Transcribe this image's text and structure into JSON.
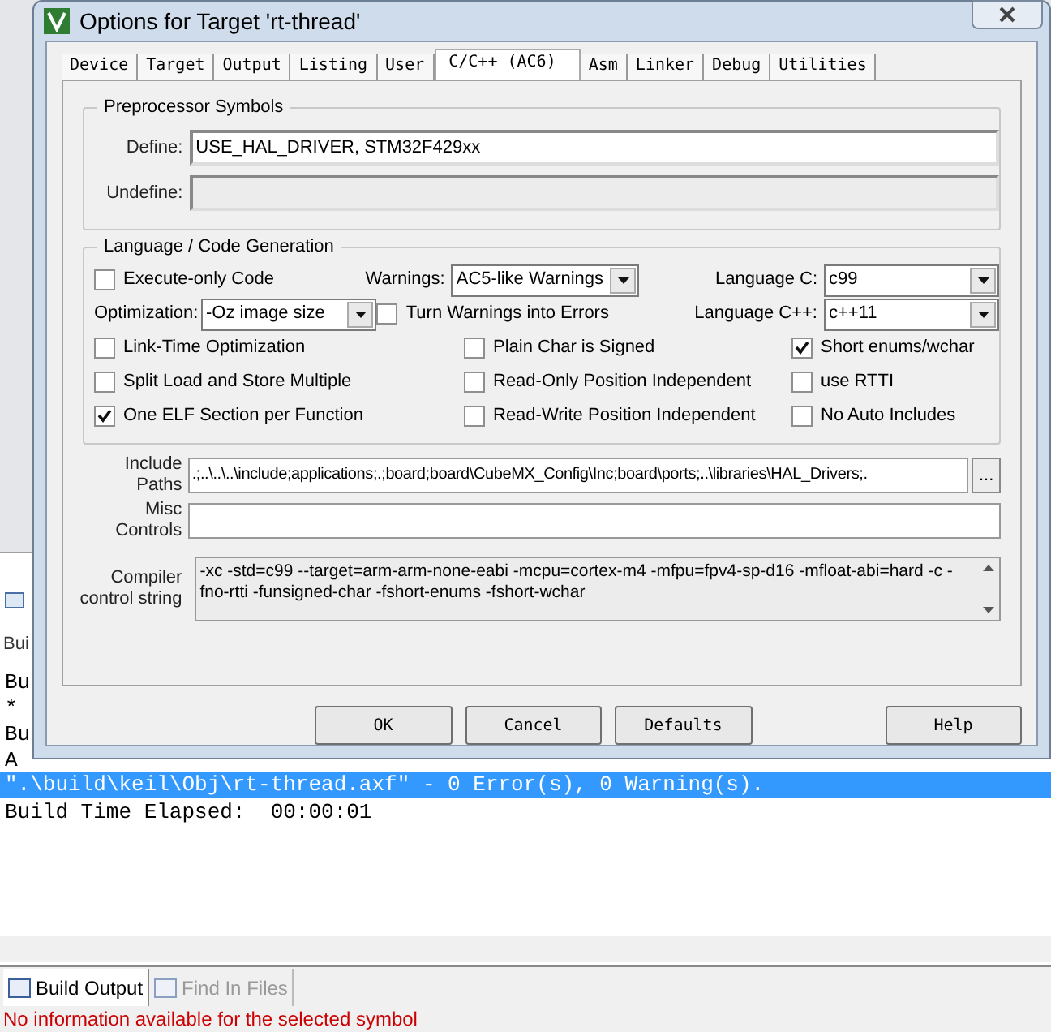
{
  "window": {
    "title": "Options for Target 'rt-thread'"
  },
  "tabs": [
    {
      "label": "Device",
      "selected": false
    },
    {
      "label": "Target",
      "selected": false
    },
    {
      "label": "Output",
      "selected": false
    },
    {
      "label": "Listing",
      "selected": false
    },
    {
      "label": "User",
      "selected": false
    },
    {
      "label": "C/C++ (AC6)",
      "selected": true
    },
    {
      "label": "Asm",
      "selected": false
    },
    {
      "label": "Linker",
      "selected": false
    },
    {
      "label": "Debug",
      "selected": false
    },
    {
      "label": "Utilities",
      "selected": false
    }
  ],
  "preprocessor": {
    "title": "Preprocessor Symbols",
    "define": {
      "label": "Define:",
      "value": "USE_HAL_DRIVER, STM32F429xx",
      "disabled": false
    },
    "undefine": {
      "label": "Undefine:",
      "disabled": true
    }
  },
  "language": {
    "title": "Language / Code Generation",
    "rows": [
      [
        {
          "kind": "checkbox",
          "label": "Execute-only Code",
          "checked": false
        },
        {
          "kind": "dropdown",
          "label": "Warnings:",
          "value": "AC5-like Warnings"
        },
        {
          "kind": "dropdown",
          "label": "Language C:",
          "value": "c99"
        }
      ],
      [
        {
          "kind": "dropdown",
          "label": "Optimization:",
          "value": "-Oz image size"
        },
        {
          "kind": "checkbox",
          "label": "Turn Warnings into Errors",
          "checked": false
        },
        {
          "kind": "dropdown",
          "label": "Language C++:",
          "value": "c++11"
        }
      ],
      [
        {
          "kind": "checkbox",
          "label": "Link-Time Optimization",
          "checked": false
        },
        {
          "kind": "checkbox",
          "label": "Plain Char is Signed",
          "checked": false
        },
        {
          "kind": "checkbox",
          "label": "Short enums/wchar",
          "checked": true
        }
      ],
      [
        {
          "kind": "checkbox",
          "label": "Split Load and Store Multiple",
          "checked": false
        },
        {
          "kind": "checkbox",
          "label": "Read-Only Position Independent",
          "checked": false
        },
        {
          "kind": "checkbox",
          "label": "use RTTI",
          "checked": false
        }
      ],
      [
        {
          "kind": "checkbox",
          "label": "One ELF Section per Function",
          "checked": true
        },
        {
          "kind": "checkbox",
          "label": "Read-Write Position Independent",
          "checked": false
        },
        {
          "kind": "checkbox",
          "label": "No Auto Includes",
          "checked": false
        }
      ]
    ]
  },
  "include_paths": {
    "label": "Include Paths",
    "value": ".;..\\..\\..\\include;applications;.;board;board\\CubeMX_Config\\Inc;board\\ports;..\\libraries\\HAL_Drivers;.",
    "button": "..."
  },
  "misc_controls": {
    "label": "Misc Controls"
  },
  "compiler_string": {
    "label": "Compiler control string",
    "value": "-xc -std=c99 --target=arm-arm-none-eabi -mcpu=cortex-m4 -mfpu=fpv4-sp-d16 -mfloat-abi=hard -c -fno-rtti -funsigned-char -fshort-enums -fshort-wchar"
  },
  "buttons": [
    "OK",
    "Cancel",
    "Defaults",
    "Help"
  ],
  "output": {
    "header": "Bui",
    "hidden_lines": [
      "Bu",
      "*",
      "Bu",
      "A"
    ],
    "lines": [
      {
        "text": "\".\\build\\keil\\Obj\\rt-thread.axf\" - 0 Error(s), 0 Warning(s).",
        "selected": true
      },
      {
        "text": "Build Time Elapsed:  00:00:01",
        "selected": false
      }
    ]
  },
  "bottom_tabs": [
    {
      "label": "Build Output",
      "selected": true
    },
    {
      "label": "Find In Files",
      "selected": false
    }
  ],
  "status_bar": "No information available for the selected symbol"
}
